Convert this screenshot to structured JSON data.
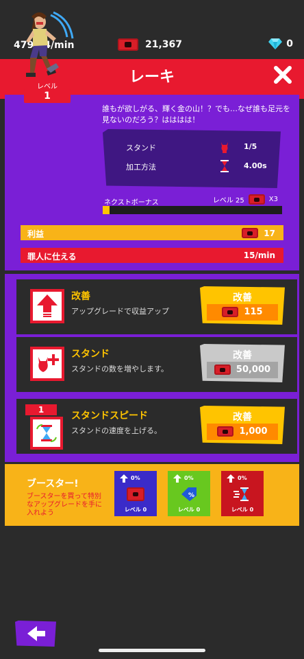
{
  "topbar": {
    "rate": "479.14/min",
    "money": "21,367",
    "gems": "0",
    "money_icon": "coin-icon",
    "gem_icon": "diamond-icon"
  },
  "header": {
    "title": "レーキ",
    "close_icon": "close-icon"
  },
  "item": {
    "level_label": "レベル",
    "level": "1",
    "description": "誰もが欲しがる、輝く金の山！？でも…なぜ誰も足元を見ないのだろう？はははは！",
    "stats": [
      {
        "label": "スタンド",
        "value": "1/5",
        "icon": "devil-icon"
      },
      {
        "label": "加工方法",
        "value": "4.00s",
        "icon": "hourglass-icon"
      }
    ],
    "next_bonus_label": "ネクストボーナス",
    "next_bonus_level": "レベル 25",
    "next_bonus_mult": "X3",
    "next_bonus_progress": 0.04,
    "profit_label": "利益",
    "profit_value": "17",
    "serve_label": "罪人に仕える",
    "serve_value": "15/min"
  },
  "upgrades": [
    {
      "title": "改善",
      "subtitle": "アップグレードで収益アップ",
      "button_label": "改善",
      "price": "115",
      "icon": "arrow-up-icon",
      "enabled": true
    },
    {
      "title": "スタンド",
      "subtitle": "スタンドの数を増やします。",
      "button_label": "改善",
      "price": "50,000",
      "icon": "add-devil-icon",
      "enabled": false
    },
    {
      "title": "スタンドスピード",
      "subtitle": "スタンドの速度を上げる。",
      "button_label": "改善",
      "price": "1,000",
      "icon": "speed-hourglass-icon",
      "enabled": true,
      "level": "1"
    }
  ],
  "boosters": {
    "title": "ブースター!",
    "subtitle": "ブースターを買って特別なアップグレードを手に入れよう",
    "items": [
      {
        "pct": "0%",
        "level": "レベル 0",
        "color": "#3a2bc9",
        "icon": "coin-icon"
      },
      {
        "pct": "0%",
        "level": "レベル 0",
        "color": "#68c81f",
        "icon": "discount-tag-icon"
      },
      {
        "pct": "0%",
        "level": "レベル 0",
        "color": "#c8151f",
        "icon": "speed-hourglass-icon"
      }
    ]
  },
  "colors": {
    "red": "#e8192f",
    "purple": "#7a1fd6",
    "yellow": "#ffc400",
    "orange": "#f8b318",
    "dark": "#2b2b2b"
  }
}
